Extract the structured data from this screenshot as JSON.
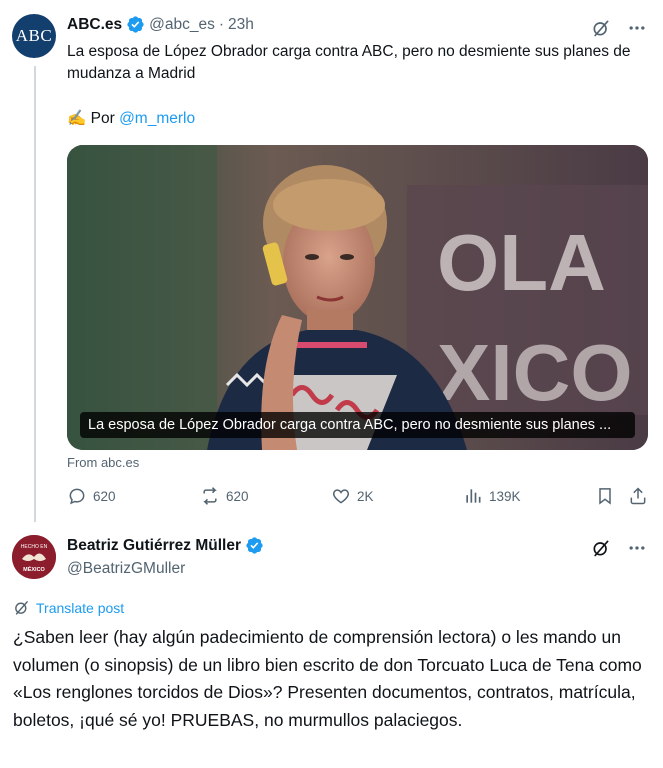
{
  "quoted_tweet": {
    "author_name": "ABC.es",
    "author_handle": "@abc_es",
    "separator": "·",
    "time": "23h",
    "avatar_text": "ABC",
    "text": "La esposa de López Obrador carga contra ABC, pero no desmiente sus planes de mudanza a Madrid",
    "byline_emoji": "✍️",
    "byline_prefix": "Por",
    "byline_link": "@m_merlo",
    "card": {
      "caption": "La esposa de López Obrador carga contra ABC, pero no desmiente sus planes ...",
      "background_letters": "OLA",
      "background_letters_2": "XICO"
    },
    "source": "From abc.es",
    "actions": {
      "replies": "620",
      "reposts": "620",
      "likes": "2K",
      "views": "139K"
    }
  },
  "main_tweet": {
    "author_name": "Beatriz Gutiérrez Müller",
    "author_handle": "@BeatrizGMuller",
    "avatar_text_top": "HECHO EN",
    "avatar_text_bottom": "MÉXICO",
    "translate_label": "Translate post",
    "text": "¿Saben leer (hay algún padecimiento de comprensión lectora) o les mando un volumen (o sinopsis) de un libro bien escrito de don Torcuato Luca de Tena como «Los renglones torcidos de Dios»? Presenten documentos, contratos, matrícula, boletos, ¡qué sé yo! PRUEBAS, no murmullos palaciegos."
  },
  "icons": [
    "verified-badge-icon",
    "grok-icon",
    "more-icon",
    "reply-icon",
    "repost-icon",
    "like-icon",
    "views-icon",
    "bookmark-icon",
    "share-icon",
    "translate-icon"
  ],
  "colors": {
    "accent": "#1d9bf0",
    "muted": "#536471",
    "text": "#0f1419",
    "abc_blue": "#123f6e"
  }
}
